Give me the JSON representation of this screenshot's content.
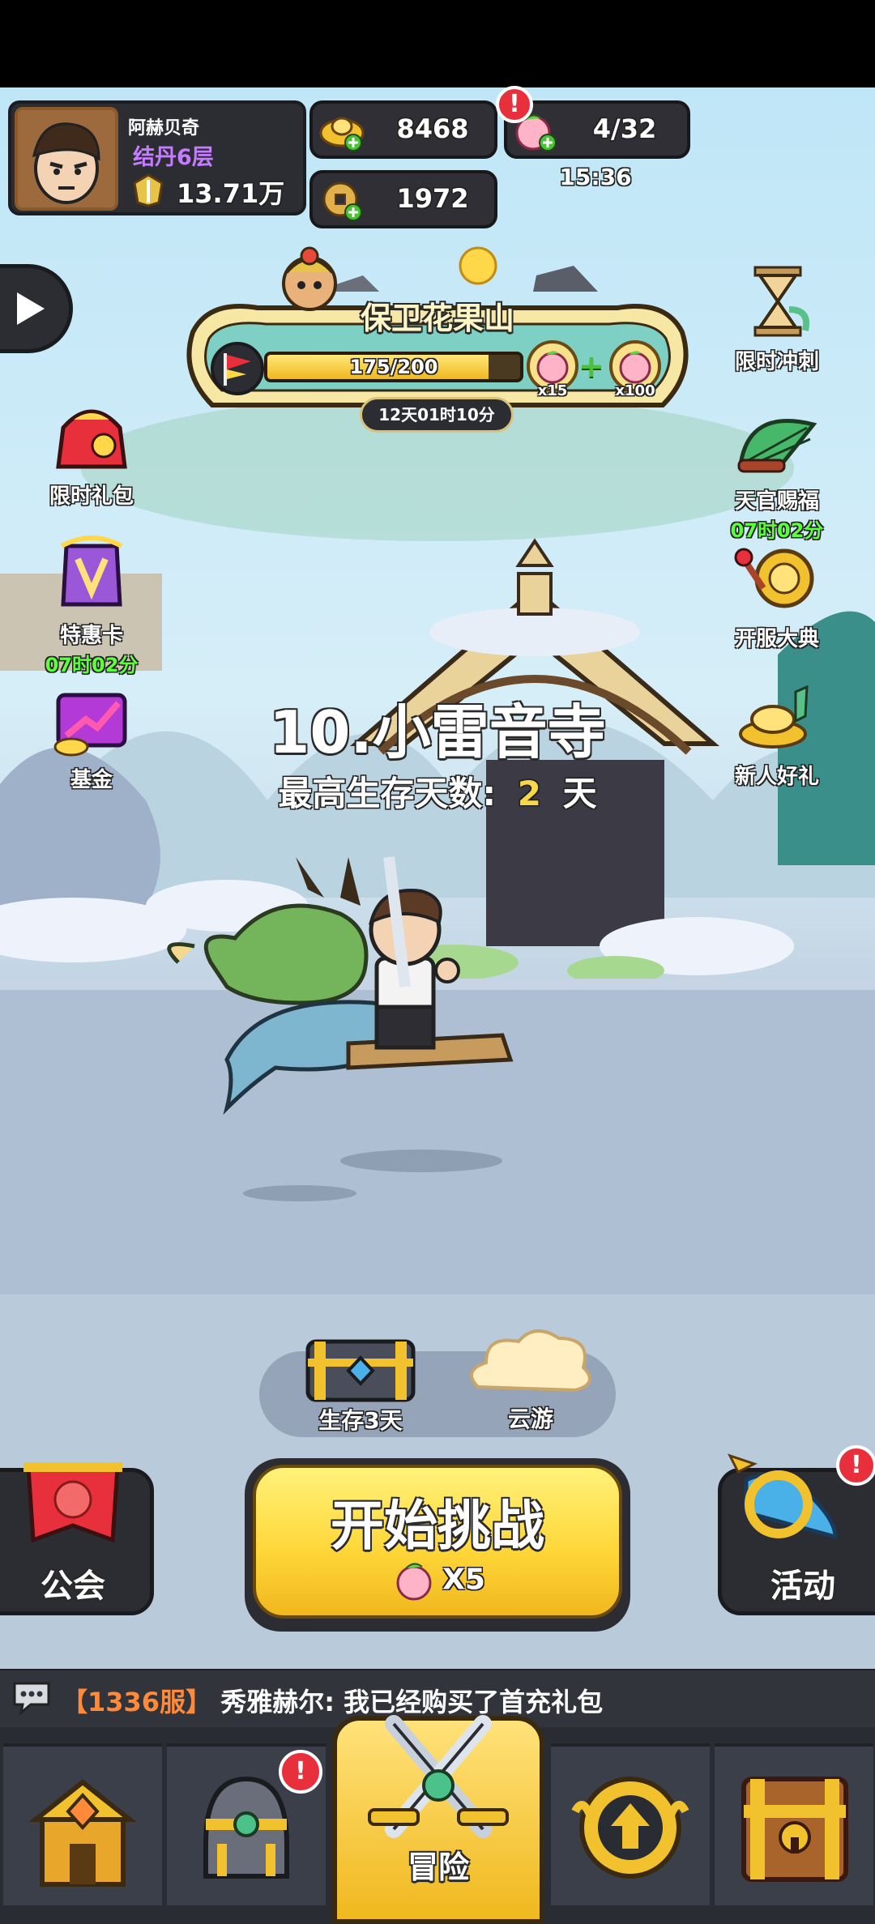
{
  "player": {
    "name": "阿赫贝奇",
    "rank": "结丹6层",
    "power": "13.71万"
  },
  "currency": {
    "gold": "8468",
    "coins": "1972"
  },
  "stamina": {
    "value": "4/32",
    "timer": "15:36"
  },
  "event": {
    "title": "保卫花果山",
    "progress_text": "175/200",
    "progress_fraction": 0.875,
    "reward1_count": "x15",
    "reward2_count": "x100",
    "countdown": "12天01时10分"
  },
  "left_buttons": {
    "gift": "限时礼包",
    "card": "特惠卡",
    "card_timer": "07时02分",
    "fund": "基金"
  },
  "right_buttons": {
    "sprint": "限时冲刺",
    "blessing": "天官赐福",
    "blessing_timer": "07时02分",
    "festival": "开服大典",
    "newbie": "新人好礼"
  },
  "stage": {
    "name": "10.小雷音寺",
    "best_label": "最高生存天数:",
    "best_value": "2",
    "best_unit": "天"
  },
  "chests": {
    "survive": "生存3天",
    "cloud": "云游"
  },
  "main_actions": {
    "guild": "公会",
    "start": "开始挑战",
    "cost": "X5",
    "activity": "活动"
  },
  "chat": {
    "server": "【1336服】",
    "speaker": "秀雅赫尔:",
    "message": "我已经购买了首充礼包"
  },
  "nav": {
    "adventure": "冒险"
  },
  "colors": {
    "accent_yellow": "#f7d84a",
    "rank_purple": "#c47dff",
    "timer_green": "#5dff3c",
    "chat_orange": "#ff8a3a",
    "badge_red": "#e8303d"
  }
}
